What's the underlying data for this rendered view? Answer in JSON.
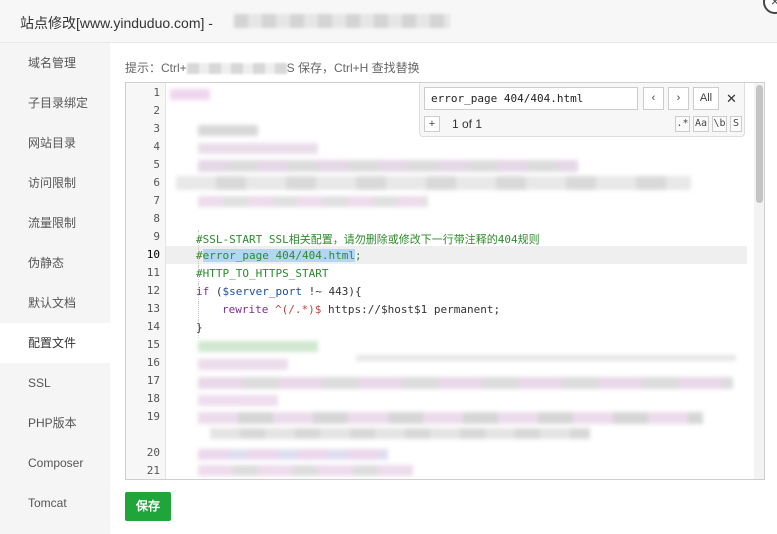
{
  "window": {
    "title": "站点修改[www.yinduduo.com] -",
    "close_glyph": "×"
  },
  "sidebar": {
    "items": [
      {
        "label": "域名管理"
      },
      {
        "label": "子目录绑定"
      },
      {
        "label": "网站目录"
      },
      {
        "label": "访问限制"
      },
      {
        "label": "流量限制"
      },
      {
        "label": "伪静态"
      },
      {
        "label": "默认文档"
      },
      {
        "label": "配置文件"
      },
      {
        "label": "SSL"
      },
      {
        "label": "PHP版本"
      },
      {
        "label": "Composer"
      },
      {
        "label": "Tomcat"
      }
    ],
    "active_item": "配置文件"
  },
  "hint": {
    "prefix": "提示：Ctrl+",
    "suffix": "S 保存，Ctrl+H 查找替换"
  },
  "editor": {
    "line_numbers": [
      "1",
      "2",
      "3",
      "4",
      "5",
      "6",
      "7",
      "8",
      "9",
      "10",
      "11",
      "12",
      "13",
      "14",
      "15",
      "16",
      "17",
      "18",
      "19",
      "20",
      "21"
    ],
    "active_line": "10",
    "code": {
      "line9": "#SSL-START SSL相关配置，请勿删除或修改下一行带注释的404规则",
      "line10_hash": "#",
      "line10_selected": "error_page 404/404.html",
      "line10_tail": ";",
      "line11": "#HTTP_TO_HTTPS_START",
      "line12_kw": "if",
      "line12_open": " (",
      "line12_var": "$server_port",
      "line12_rest": " !~ 443){",
      "line13_kw": "rewrite",
      "line13_regex": " ^(/.*)$",
      "line13_rest": " https://$host$1 permanent;",
      "line14": "}"
    }
  },
  "search": {
    "query": "error_page 404/404.html",
    "prev_glyph": "‹",
    "next_glyph": "›",
    "all_label": "All",
    "close_glyph": "✕",
    "plus_glyph": "+",
    "match_count": "1 of 1",
    "opt_regex": ".*",
    "opt_case": "Aa",
    "opt_word": "\\b",
    "opt_selection": "S"
  },
  "actions": {
    "save_label": "保存"
  },
  "colors": {
    "save_button": "#20a53a",
    "comment": "#2e8b2e",
    "keyword": "#7a2f91",
    "selection": "#b5d5f5"
  }
}
